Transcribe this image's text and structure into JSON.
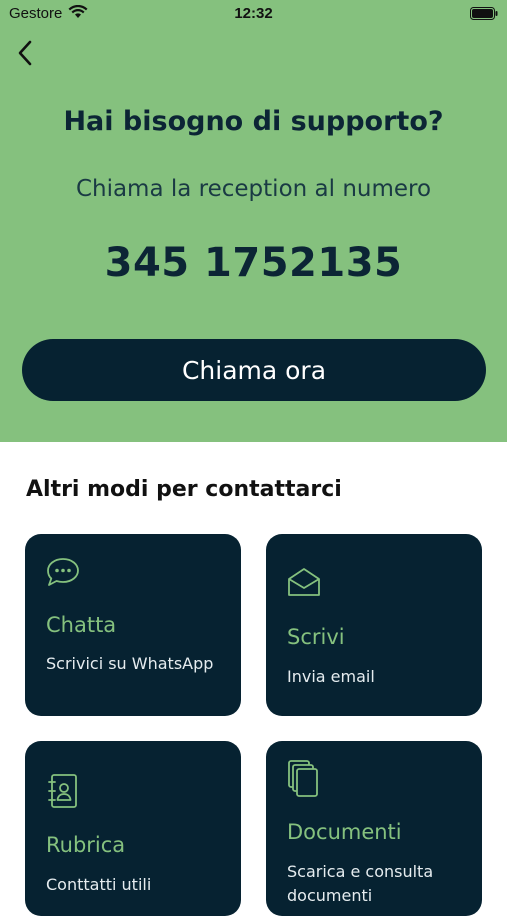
{
  "status_bar": {
    "carrier": "Gestore",
    "time": "12:32"
  },
  "hero": {
    "title": "Hai bisogno di supporto?",
    "subtitle": "Chiama la reception al numero",
    "phone": "345 1752135",
    "call_button": "Chiama ora"
  },
  "section_title": "Altri modi per contattarci",
  "cards": [
    {
      "title": "Chatta",
      "subtitle": "Scrivici su WhatsApp",
      "icon": "chat-bubble-icon"
    },
    {
      "title": "Scrivi",
      "subtitle": "Invia email",
      "icon": "envelope-icon"
    },
    {
      "title": "Rubrica",
      "subtitle": "Conttatti utili",
      "icon": "address-book-icon"
    },
    {
      "title": "Documenti",
      "subtitle": "Scarica e consulta documenti",
      "icon": "documents-icon"
    }
  ],
  "colors": {
    "hero_bg": "#85c17e",
    "dark": "#062231",
    "accent": "#85c17e"
  }
}
